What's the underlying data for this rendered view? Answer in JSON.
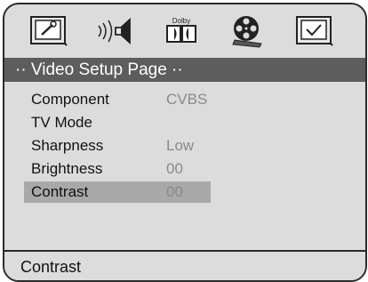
{
  "tabs": [
    {
      "icon": "wrench-tv-icon"
    },
    {
      "icon": "speaker-icon"
    },
    {
      "icon": "dolby-icon",
      "label": "Dolby"
    },
    {
      "icon": "film-reel-icon"
    },
    {
      "icon": "checkmark-tv-icon"
    }
  ],
  "title": "·· Video Setup Page ··",
  "items": [
    {
      "label": "Component",
      "value": "CVBS"
    },
    {
      "label": "TV Mode",
      "value": ""
    },
    {
      "label": "Sharpness",
      "value": "Low"
    },
    {
      "label": "Brightness",
      "value": "00"
    },
    {
      "label": "Contrast",
      "value": "00",
      "selected": true
    }
  ],
  "status": "Contrast",
  "colors": {
    "background": "#dcdcdc",
    "titlebar": "#5d5d5d",
    "selection": "#a9a9a9",
    "value_text": "#8a8a8a"
  }
}
